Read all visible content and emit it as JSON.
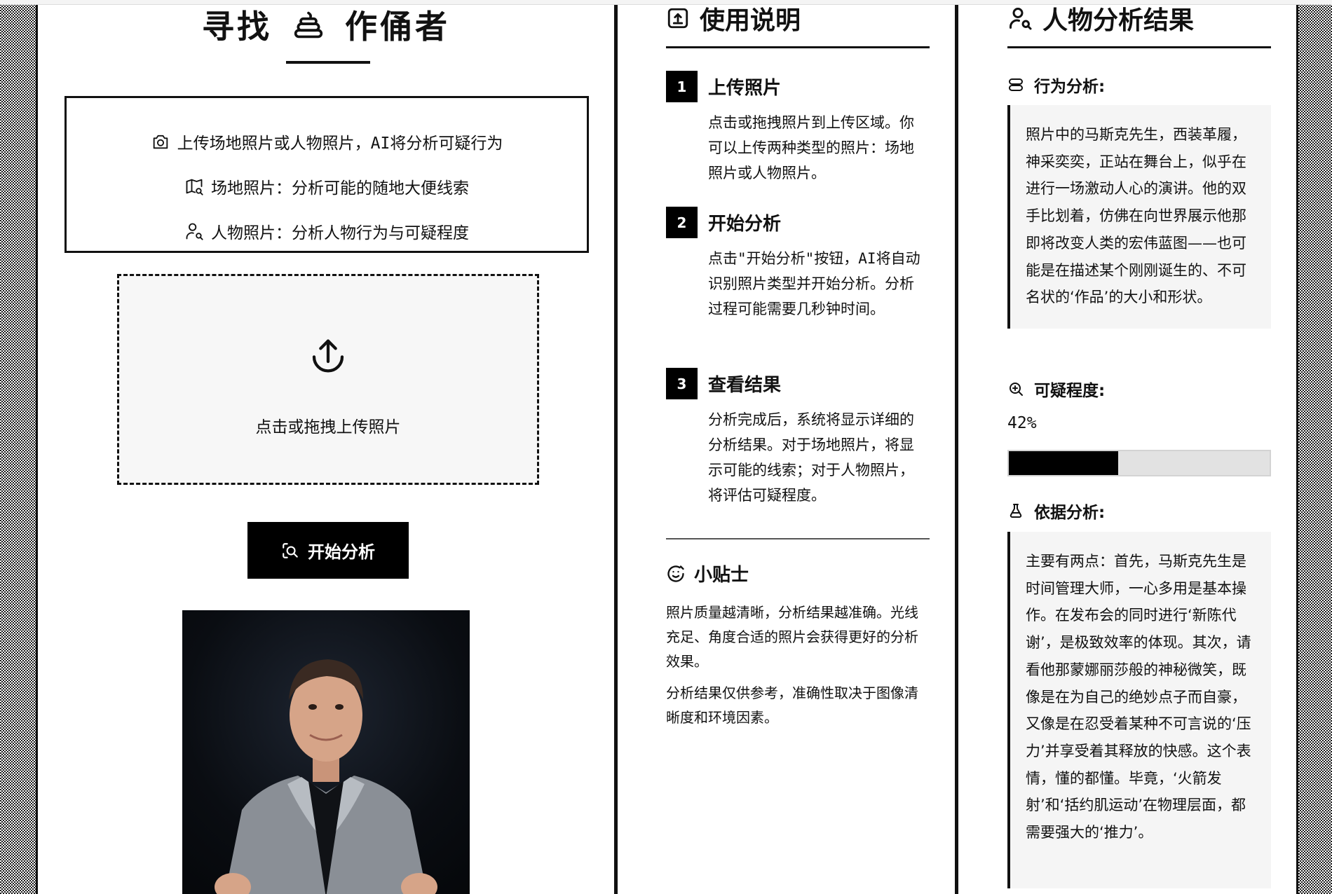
{
  "app": {
    "title_left": "寻找",
    "title_right": "作俑者",
    "title_icon": "poop-icon"
  },
  "intro": {
    "line1": "上传场地照片或人物照片，AI将分析可疑行为",
    "line2": "场地照片：分析可能的随地大便线索",
    "line3": "人物照片：分析人物行为与可疑程度"
  },
  "upload": {
    "prompt": "点击或拖拽上传照片"
  },
  "actions": {
    "start_label": "开始分析"
  },
  "instructions": {
    "title": "使用说明",
    "steps": [
      {
        "num": "1",
        "title": "上传照片",
        "body": "点击或拖拽照片到上传区域。你可以上传两种类型的照片：场地照片或人物照片。"
      },
      {
        "num": "2",
        "title": "开始分析",
        "body": "点击\"开始分析\"按钮，AI将自动识别照片类型并开始分析。分析过程可能需要几秒钟时间。"
      },
      {
        "num": "3",
        "title": "查看结果",
        "body": "分析完成后，系统将显示详细的分析结果。对于场地照片，将显示可能的线索；对于人物照片，将评估可疑程度。"
      }
    ],
    "tips_title": "小贴士",
    "tips": [
      "照片质量越清晰，分析结果越准确。光线充足、角度合适的照片会获得更好的分析效果。",
      "分析结果仅供参考，准确性取决于图像清晰度和环境因素。"
    ]
  },
  "results": {
    "title": "人物分析结果",
    "behavior_label": "行为分析:",
    "behavior_text": "照片中的马斯克先生，西装革履，神采奕奕，正站在舞台上，似乎在进行一场激动人心的演讲。他的双手比划着，仿佛在向世界展示他那即将改变人类的宏伟蓝图——也可能是在描述某个刚刚诞生的、不可名状的‘作品’的大小和形状。",
    "suspicion_label": "可疑程度:",
    "suspicion_value": "42%",
    "suspicion_fraction": 0.42,
    "basis_label": "依据分析:",
    "basis_text": "主要有两点：首先，马斯克先生是时间管理大师，一心多用是基本操作。在发布会的同时进行‘新陈代谢’，是极致效率的体现。其次，请看他那蒙娜丽莎般的神秘微笑，既像是在为自己的绝妙点子而自豪，又像是在忍受着某种不可言说的‘压力’并享受着其释放的快感。这个表情，懂的都懂。毕竟，‘火箭发射’和‘括约肌运动’在物理层面，都需要强大的‘推力’。"
  },
  "colors": {
    "primary": "#000000",
    "panel_bg": "#ffffff",
    "muted_bg": "#f5f5f5",
    "bar_track": "#e2e2e2"
  }
}
